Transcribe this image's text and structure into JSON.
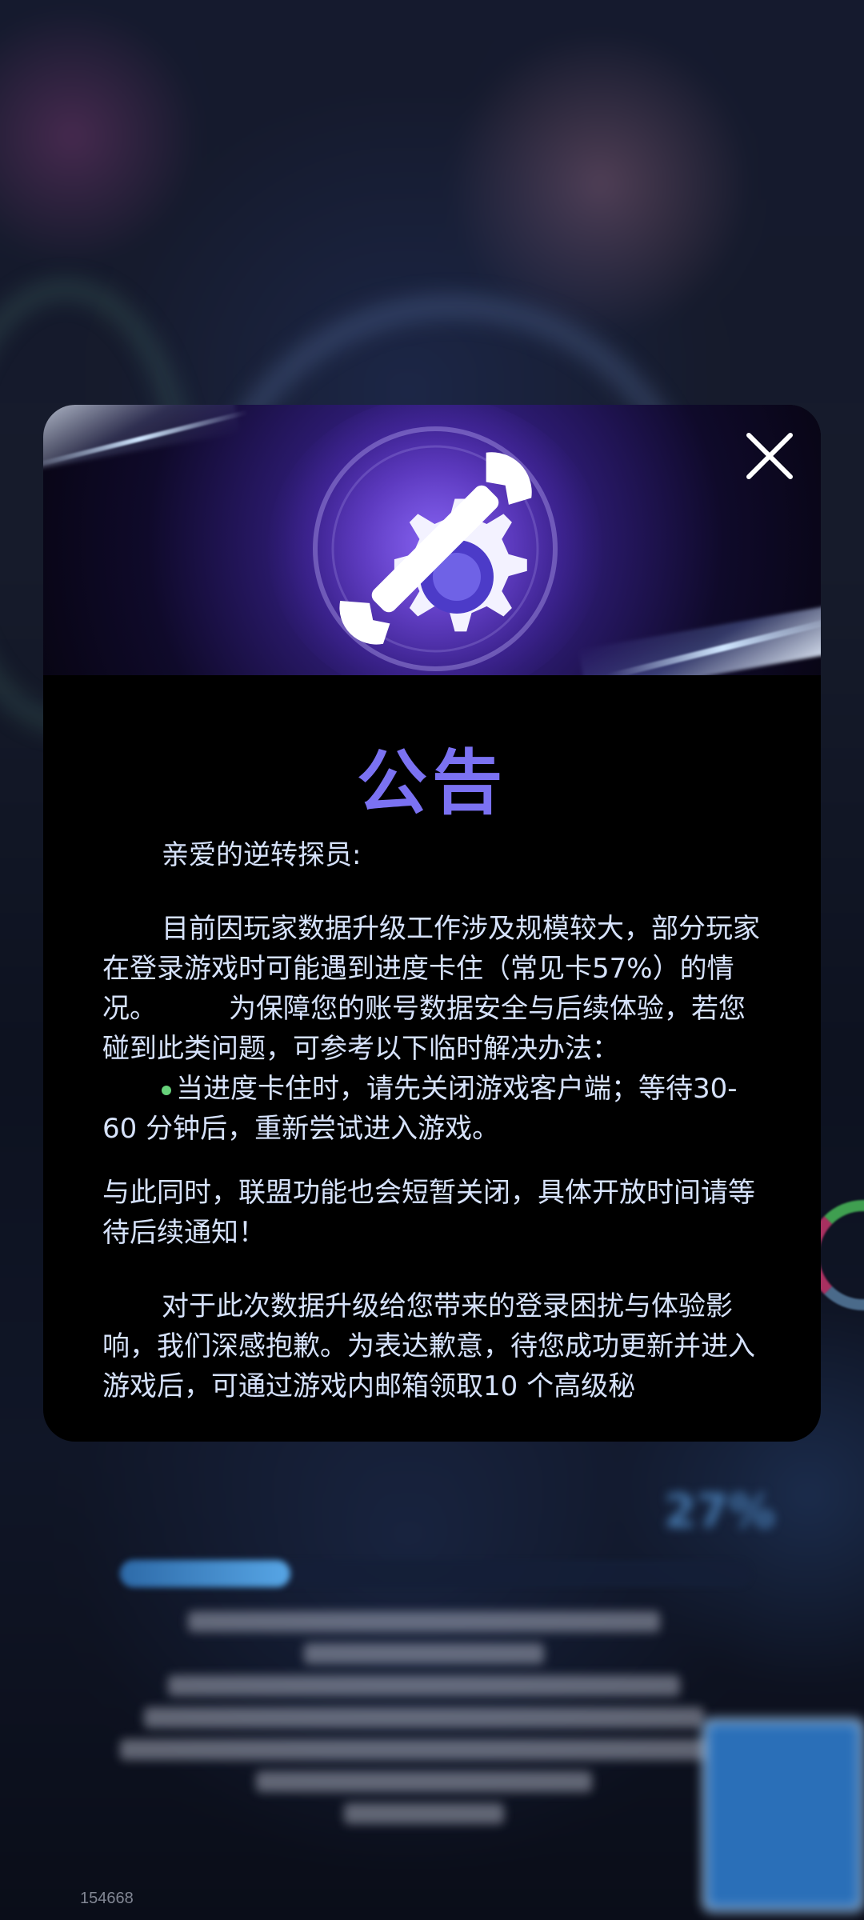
{
  "background": {
    "blurred_title": "",
    "percent_label": "27%",
    "progress": 0.27
  },
  "build_id": "154668",
  "modal": {
    "title": "公告",
    "close_icon": "close-icon",
    "banner_icon": "wrench-gear-icon",
    "greeting": "亲爱的逆转探员:",
    "paragraph_1a": "目前因玩家数据升级工作涉及规模较大，部分玩家在登录游戏时可能遇到进度卡住（常见卡57%）的情况。",
    "paragraph_1b": "为保障您的账号数据安全与后续体验，若您碰到此类问题，可参考以下临时解决办法：",
    "bullet_1": "当进度卡住时，请先关闭游戏客户端；等待30-60 分钟后，重新尝试进入游戏。",
    "paragraph_2": "与此同时，联盟功能也会短暂关闭，具体开放时间请等待后续通知！",
    "paragraph_3": "对于此次数据升级给您带来的登录困扰与体验影响，我们深感抱歉。为表达歉意，待您成功更新并进入游戏后，可通过游戏内邮箱领取10 个高级秘"
  },
  "colors": {
    "title_color": "#7b72f2",
    "text_color": "#d6e2fb",
    "bullet_color": "#67d27a",
    "modal_bg": "#000000"
  }
}
